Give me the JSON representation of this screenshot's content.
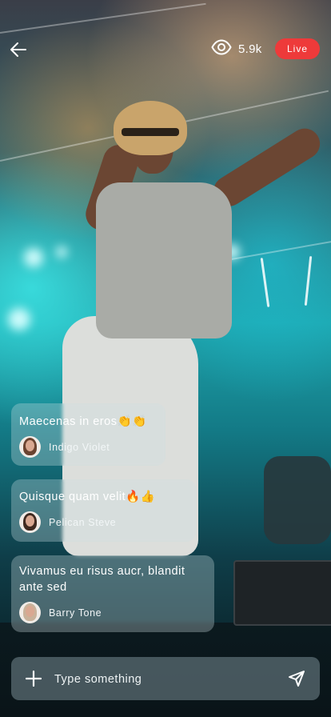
{
  "header": {
    "back_icon": "arrow-left-icon",
    "viewer_icon": "eye-icon",
    "viewer_count": "5.9k",
    "live_label": "Live",
    "live_color": "#ee3a3a"
  },
  "comments": [
    {
      "message": "Maecenas in eros👏👏",
      "username": "Indigo Violet"
    },
    {
      "message": "Quisque quam velit🔥👍",
      "username": "Pelican Steve"
    },
    {
      "message": "Vivamus eu risus aucr, blandit ante sed",
      "username": "Barry Tone"
    }
  ],
  "composer": {
    "add_icon": "plus-icon",
    "placeholder": "Type something",
    "send_icon": "send-icon"
  }
}
